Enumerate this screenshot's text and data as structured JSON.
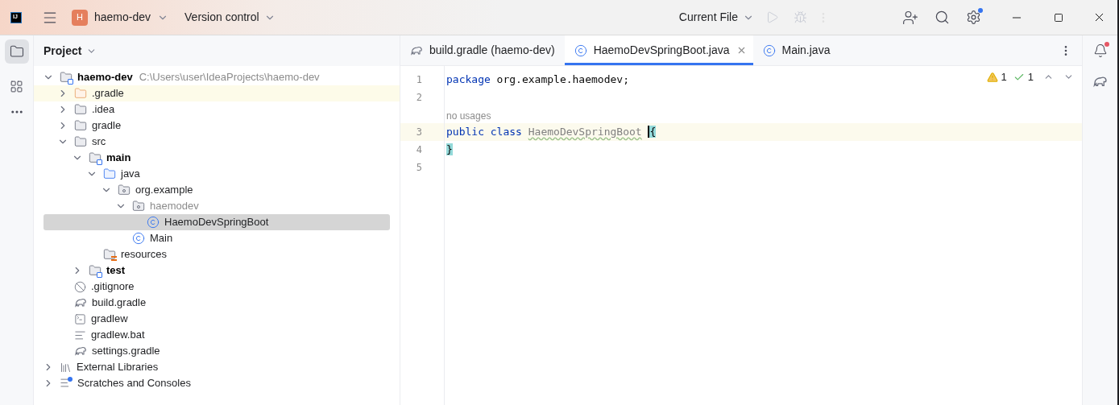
{
  "title_bar": {
    "logo": "IJ",
    "project": {
      "badge": "H",
      "name": "haemo-dev"
    },
    "vcs": "Version control",
    "run_config": "Current File"
  },
  "project_panel": {
    "title": "Project",
    "tree": [
      {
        "name": "haemo-dev",
        "kind": "module",
        "path": "C:\\Users\\user\\IdeaProjects\\haemo-dev",
        "expanded": true,
        "selected": false,
        "children": [
          {
            "name": ".gradle",
            "kind": "excluded-folder",
            "expanded": false,
            "selected": false
          },
          {
            "name": ".idea",
            "kind": "folder",
            "expanded": false,
            "selected": false
          },
          {
            "name": "gradle",
            "kind": "folder",
            "expanded": false,
            "selected": false
          },
          {
            "name": "src",
            "kind": "folder",
            "expanded": true,
            "selected": false,
            "children": [
              {
                "name": "main",
                "kind": "module",
                "expanded": true,
                "selected": false,
                "children": [
                  {
                    "name": "java",
                    "kind": "source-folder",
                    "expanded": true,
                    "selected": false,
                    "children": [
                      {
                        "name": "org.example",
                        "kind": "package",
                        "expanded": true,
                        "selected": false,
                        "children": [
                          {
                            "name": "haemodev",
                            "kind": "empty-package",
                            "expanded": true,
                            "selected": false,
                            "children": [
                              {
                                "name": "HaemoDevSpringBoot",
                                "kind": "class",
                                "selected": true
                              }
                            ]
                          },
                          {
                            "name": "Main",
                            "kind": "class",
                            "selected": false
                          }
                        ]
                      }
                    ]
                  },
                  {
                    "name": "resources",
                    "kind": "resources-folder",
                    "selected": false
                  }
                ]
              },
              {
                "name": "test",
                "kind": "module",
                "expanded": false,
                "selected": false
              }
            ]
          },
          {
            "name": ".gitignore",
            "kind": "ignore-file",
            "selected": false
          },
          {
            "name": "build.gradle",
            "kind": "gradle-file",
            "selected": false
          },
          {
            "name": "gradlew",
            "kind": "script-file",
            "selected": false
          },
          {
            "name": "gradlew.bat",
            "kind": "text-file",
            "selected": false
          },
          {
            "name": "settings.gradle",
            "kind": "gradle-file",
            "selected": false
          }
        ]
      },
      {
        "name": "External Libraries",
        "kind": "libraries",
        "expanded": false,
        "selected": false
      },
      {
        "name": "Scratches and Consoles",
        "kind": "scratches",
        "expanded": false,
        "selected": false
      }
    ]
  },
  "editor": {
    "tabs": [
      {
        "label": "build.gradle (haemo-dev)",
        "kind": "gradle",
        "selected": false
      },
      {
        "label": "HaemoDevSpringBoot.java",
        "kind": "class",
        "selected": true
      },
      {
        "label": "Main.java",
        "kind": "class",
        "selected": false
      }
    ],
    "warnings": "1",
    "typos": "1",
    "lines": [
      {
        "number": "1",
        "current": false,
        "tokens": [
          {
            "text": "package",
            "kind": "keyword"
          },
          {
            "text": " org.example.haemodev;",
            "kind": "plain"
          }
        ]
      },
      {
        "number": "2",
        "current": false
      },
      {
        "number": "3",
        "current": true,
        "hint": "no usages",
        "tokens": [
          {
            "text": "public class ",
            "kind": "keyword"
          },
          {
            "text": "HaemoDevSpringBoot",
            "kind": "unused"
          },
          {
            "text": "{",
            "kind": "brace-caret",
            "space_before": true
          }
        ]
      },
      {
        "number": "4",
        "current": false,
        "tokens": [
          {
            "text": "}",
            "kind": "brace"
          }
        ]
      },
      {
        "number": "5",
        "current": false
      }
    ]
  }
}
